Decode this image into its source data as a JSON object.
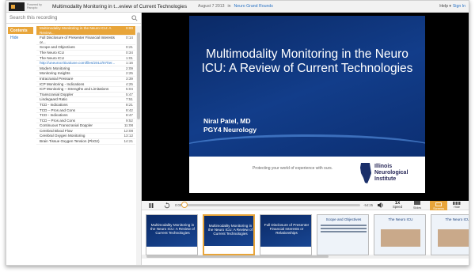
{
  "app": {
    "powered_by": "Powered by Panopto",
    "title": "Multimodality Monitoring in t...eview of Current Technologies",
    "date": "August 7 2013",
    "folder_prefix": "in",
    "folder": "Neuro Grand Rounds",
    "help_label": "Help ▾",
    "signin_label": "Sign In"
  },
  "sidebar": {
    "search_placeholder": "Search this recording",
    "tabs": [
      {
        "label": "Contents"
      },
      {
        "label": "Hide"
      }
    ],
    "toc": [
      {
        "title": "Multimodality Monitoring in the Neuro ICU: A Review...",
        "time": "0:00"
      },
      {
        "title": "Full Disclosure of Presenter Financial Interests or...",
        "time": "0:14"
      },
      {
        "title": "Scope and Objectives",
        "time": "0:21"
      },
      {
        "title": "The Neuro ICU",
        "time": "0:34"
      },
      {
        "title": "The Neuro ICU",
        "time": "1:01"
      },
      {
        "title": "http://uneurocriticalcare.com/files/2012/07/ter...",
        "time": "1:16"
      },
      {
        "title": "Modern Monitoring",
        "time": "2:09"
      },
      {
        "title": "Monitoring Insights",
        "time": "2:25"
      },
      {
        "title": "Intracranial Pressure",
        "time": "3:39"
      },
      {
        "title": "ICP Monitoring - Indications",
        "time": "4:25"
      },
      {
        "title": "ICP Monitoring – Strengths and Limitations",
        "time": "5:04"
      },
      {
        "title": "Transcranial Doppler",
        "time": "5:47"
      },
      {
        "title": "Lindegaard Ratio",
        "time": "7:51"
      },
      {
        "title": "TCD - Indications",
        "time": "8:21"
      },
      {
        "title": "TCD – Pros and Cons",
        "time": "8:42"
      },
      {
        "title": "TCD - Indications",
        "time": "8:47"
      },
      {
        "title": "TCD – Pros and Cons",
        "time": "9:52"
      },
      {
        "title": "Continuous Transcranial Doppler",
        "time": "11:08"
      },
      {
        "title": "Cerebral Blood Flow",
        "time": "12:08"
      },
      {
        "title": "Cerebral Oxygen Monitoring",
        "time": "13:12"
      },
      {
        "title": "Brain Tissue Oxygen Tension (PbO2)",
        "time": "14:21"
      }
    ]
  },
  "slide": {
    "title": "Multimodality Monitoring in the Neuro ICU: A Review of Current Technologies",
    "presenter_name": "Niral Patel, MD",
    "presenter_role": "PGY4 Neurology",
    "tagline": "Protecting your world of experience with ours.",
    "logo_text": "Illinois Neurological Institute"
  },
  "controls": {
    "play_icon": "pause-icon",
    "time_current": "0:00",
    "time_total": "-54:25",
    "progress": 0.0,
    "speed_value": "1x",
    "speed_label": "Speed",
    "slides_label": "Slides",
    "screens_label": "Screens",
    "hide_label": "Hide"
  },
  "thumbnails": [
    {
      "text": "Multimodality Monitoring in the Neuro ICU: A Review of Current Technologies",
      "style": "blue"
    },
    {
      "text": "Multimodality Monitoring in the Neuro ICU: A Review of Current Technologies",
      "style": "blue"
    },
    {
      "text": "Full Disclosure of Presenter Financial Interests or Relationships",
      "style": "blue"
    },
    {
      "text": "Scope and Objectives",
      "style": "light"
    },
    {
      "text": "The Neuro ICU",
      "style": "light"
    },
    {
      "text": "The Neuro ICU",
      "style": "light"
    }
  ],
  "colors": {
    "accent": "#e8a53a",
    "link": "#2a73c4",
    "slide_bg": "#123d8a"
  }
}
